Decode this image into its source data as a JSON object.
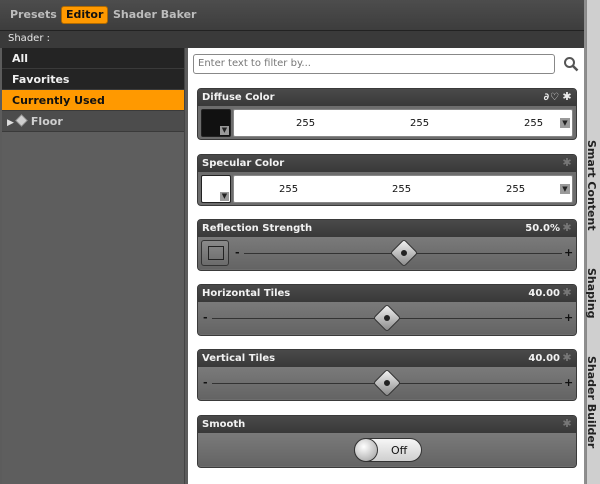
{
  "tabs": [
    {
      "label": "Presets",
      "active": false
    },
    {
      "label": "Editor",
      "active": true
    },
    {
      "label": "Shader Baker",
      "active": false
    }
  ],
  "shader_label": "Shader :",
  "categories": [
    {
      "label": "All",
      "selected": false
    },
    {
      "label": "Favorites",
      "selected": false
    },
    {
      "label": "Currently Used",
      "selected": true
    },
    {
      "label": "Floor",
      "selected": false,
      "tree": true
    }
  ],
  "filter": {
    "placeholder": "Enter text to filter by..."
  },
  "properties": {
    "diffuse": {
      "label": "Diffuse Color",
      "r": "255",
      "g": "255",
      "b": "255",
      "swatch": "#111111"
    },
    "specular": {
      "label": "Specular Color",
      "r": "255",
      "g": "255",
      "b": "255",
      "swatch": "#ffffff"
    },
    "reflection": {
      "label": "Reflection Strength",
      "value": "50.0%",
      "fraction": 0.5
    },
    "htiles": {
      "label": "Horizontal Tiles",
      "value": "40.00",
      "fraction": 0.5
    },
    "vtiles": {
      "label": "Vertical Tiles",
      "value": "40.00",
      "fraction": 0.5
    },
    "smooth": {
      "label": "Smooth",
      "state": "Off"
    }
  },
  "slider_symbols": {
    "minus": "-",
    "plus": "+"
  },
  "side_tabs": [
    "Smart Content",
    "Shaping",
    "Shader Builder"
  ],
  "colors": {
    "accent": "#ff9900",
    "header": "#3d3d3d"
  }
}
